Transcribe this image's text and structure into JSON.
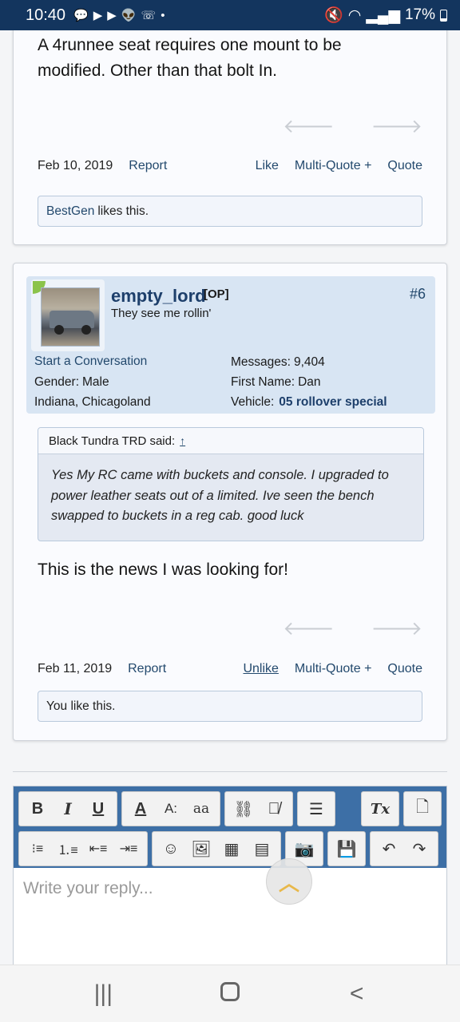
{
  "status": {
    "time": "10:40",
    "notif_icons": [
      "chat-icon",
      "youtube-icon",
      "youtube-icon",
      "reddit-icon",
      "missed-call-icon",
      "dot-icon"
    ],
    "battery": "17%"
  },
  "post1": {
    "text_line1": "A 4runnee seat requires one mount to be",
    "text_line2": "modified. Other than that bolt In.",
    "date": "Feb 10, 2019",
    "report": "Report",
    "like": "Like",
    "multiquote": "Multi-Quote +",
    "quote": "Quote",
    "likes_user": "BestGen",
    "likes_suffix": "likes this."
  },
  "post2": {
    "username": "empty_lord",
    "op_tag": "[OP]",
    "user_title": "They see me rollin'",
    "post_number": "#6",
    "start_conversation": "Start a Conversation",
    "gender_label": "Gender:",
    "gender_value": "Male",
    "location": "Indiana, Chicagoland",
    "messages_label": "Messages:",
    "messages_value": "9,404",
    "first_name_label": "First Name:",
    "first_name_value": "Dan",
    "vehicle_label": "Vehicle:",
    "vehicle_value": "05 rollover special",
    "quote_author": "Black Tundra TRD said:",
    "quote_up": "↑",
    "quote_line1": "Yes My RC came with buckets and console. I upgraded to",
    "quote_line2": "power leather seats out of a limited. Ive seen the bench",
    "quote_line3": "swapped to buckets in a reg cab. good luck",
    "text": "This is the news I was looking for!",
    "date": "Feb 11, 2019",
    "report": "Report",
    "unlike": "Unlike",
    "multiquote": "Multi-Quote +",
    "quote": "Quote",
    "likes_text": "You like this."
  },
  "editor": {
    "placeholder": "Write your reply...",
    "bold": "B",
    "italic": "I",
    "underline": "U",
    "font_color": "A",
    "font_size": "A:",
    "font_family": "aa",
    "clear_format": "Tx"
  },
  "colors": {
    "statusbar": "#13355e",
    "link": "#23496d",
    "toolbar": "#3d6fa6",
    "userinfo_bg": "#d8e5f3"
  }
}
